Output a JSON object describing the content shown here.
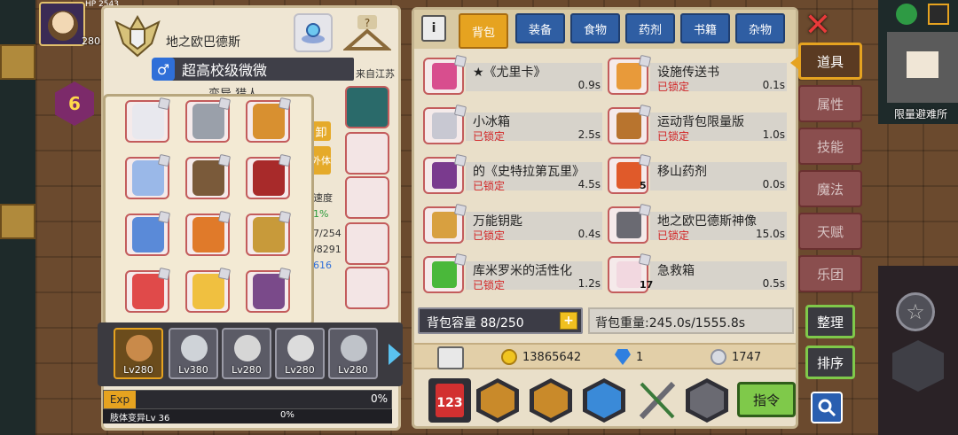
{
  "hud": {
    "hp_value": "2543",
    "mp_value": "280"
  },
  "hex_level": "6",
  "hero": {
    "name": "地之欧巴德斯",
    "player_name": "超高校级微微",
    "from": "来自江苏",
    "class": "变异 猎人"
  },
  "side_info": {
    "tag1": "卸",
    "tag2": "外体",
    "text_speed": "速度",
    "text_pct": "1%",
    "text_hp": "7/254",
    "text_mp": "/8291",
    "text_616": "616"
  },
  "party": [
    {
      "level": "Lv280",
      "face": "#c98a4a"
    },
    {
      "level": "Lv380",
      "face": "#cfd3d8"
    },
    {
      "level": "Lv280",
      "face": "#d6d6d6"
    },
    {
      "level": "Lv280",
      "face": "#dcdcdc"
    },
    {
      "level": "Lv280",
      "face": "#bfc3c9"
    }
  ],
  "exp": {
    "label": "Exp",
    "pct": "0%"
  },
  "mutation": {
    "label": "肢体变异Lv 36",
    "pct": "0%"
  },
  "tabs": [
    {
      "label": "背包",
      "active": true
    },
    {
      "label": "装备",
      "active": false
    },
    {
      "label": "食物",
      "active": false
    },
    {
      "label": "药剂",
      "active": false
    },
    {
      "label": "书籍",
      "active": false
    },
    {
      "label": "杂物",
      "active": false
    }
  ],
  "items": [
    {
      "name": "★《尤里卡》",
      "locked": "",
      "weight": "0.9s",
      "count": "",
      "color": "#d84e8e"
    },
    {
      "name": "设施传送书",
      "locked": "已锁定",
      "weight": "0.1s",
      "count": "",
      "color": "#e89a3a"
    },
    {
      "name": "小冰箱",
      "locked": "已锁定",
      "weight": "2.5s",
      "count": "",
      "color": "#c8c8d2"
    },
    {
      "name": "运动背包限量版",
      "locked": "已锁定",
      "weight": "1.0s",
      "count": "",
      "color": "#b8742e"
    },
    {
      "name": "的《史特拉第瓦里》",
      "locked": "已锁定",
      "weight": "4.5s",
      "count": "",
      "color": "#7a3a8e"
    },
    {
      "name": "移山药剂",
      "locked": "",
      "weight": "0.0s",
      "count": "5",
      "color": "#e05a2a"
    },
    {
      "name": "万能钥匙",
      "locked": "已锁定",
      "weight": "0.4s",
      "count": "",
      "color": "#d8a040"
    },
    {
      "name": "地之欧巴德斯神像",
      "locked": "已锁定",
      "weight": "15.0s",
      "count": "",
      "color": "#6a6a72"
    },
    {
      "name": "库米罗米的活性化",
      "locked": "已锁定",
      "weight": "1.2s",
      "count": "",
      "color": "#4ab83a"
    },
    {
      "name": "急救箱",
      "locked": "",
      "weight": "0.5s",
      "count": "17",
      "color": "#f2d8e0"
    }
  ],
  "capacity": {
    "label": "背包容量 88/250",
    "plus": "+"
  },
  "weight": "背包重量:245.0s/1555.8s",
  "currency": {
    "gold": "13865642",
    "gems": "1",
    "tokens": "1747"
  },
  "command_label": "指令",
  "side_menu": [
    {
      "label": "道具",
      "active": true
    },
    {
      "label": "属性",
      "active": false
    },
    {
      "label": "技能",
      "active": false
    },
    {
      "label": "魔法",
      "active": false
    },
    {
      "label": "天赋",
      "active": false
    },
    {
      "label": "乐团",
      "active": false
    }
  ],
  "tools": {
    "tidy": "整理",
    "sort": "排序"
  },
  "minimap_label": "限量避难所",
  "colors": {
    "accent": "#e6a320",
    "tab_blue": "#2f5ea3",
    "locked_red": "#d32424",
    "command_green": "#7fc94a"
  }
}
